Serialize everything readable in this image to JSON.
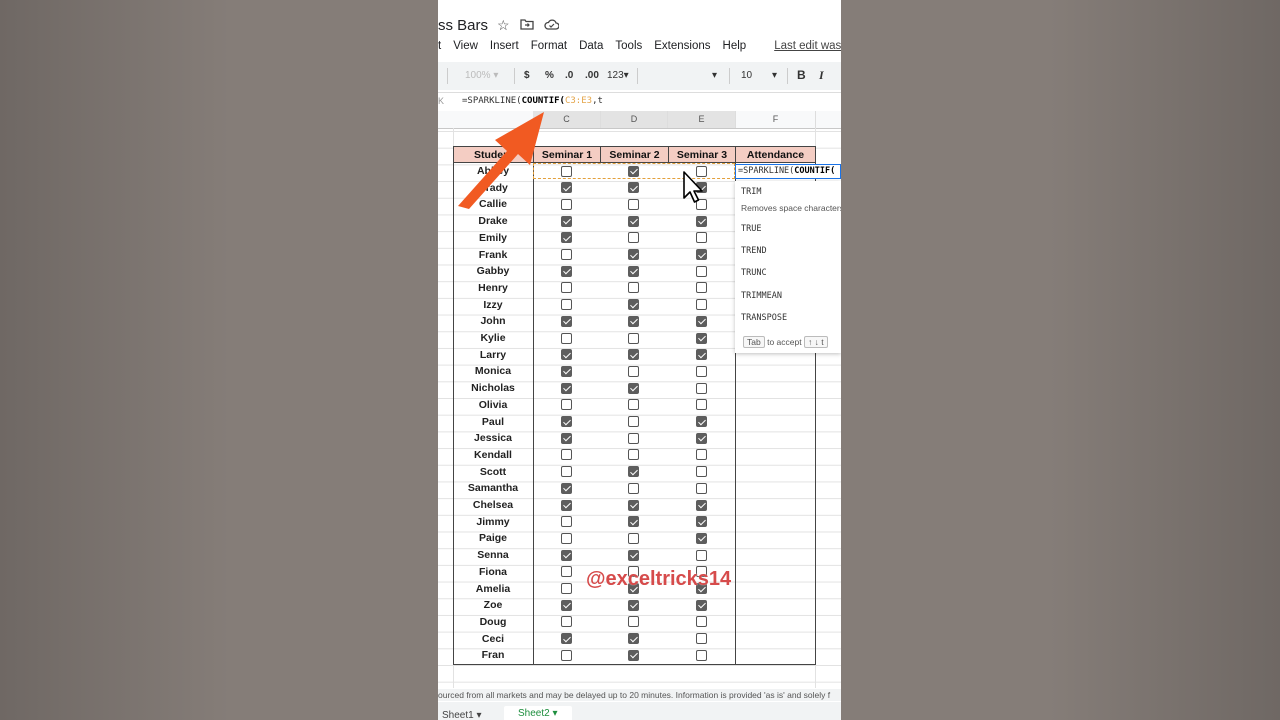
{
  "doc_title": "ss Bars",
  "icons": [
    "star-icon",
    "move-to-folder-icon",
    "cloud-status-icon"
  ],
  "menu": [
    "t",
    "View",
    "Insert",
    "Format",
    "Data",
    "Tools",
    "Extensions",
    "Help"
  ],
  "last_edit": "Last edit was sec",
  "toolbar": {
    "zoom": "100%",
    "currency": "$",
    "percent": "%",
    "dec_less": ".0",
    "dec_more": ".00",
    "format_more": "123▾",
    "font_size": "10",
    "bold": "B",
    "italic": "I"
  },
  "formula_bar": {
    "name_box": "K",
    "prefix": "=SPARKLINE(",
    "func": "COUNTIF(",
    "range": "C3:E3",
    "suffix": ",t"
  },
  "columns": [
    "C",
    "D",
    "E",
    "F"
  ],
  "table": {
    "headers": [
      "Student",
      "Seminar 1",
      "Seminar 2",
      "Seminar 3",
      "Attendance"
    ],
    "rows": [
      {
        "name": "Abbey",
        "s": [
          false,
          true,
          false
        ]
      },
      {
        "name": "Brady",
        "s": [
          true,
          true,
          true
        ]
      },
      {
        "name": "Callie",
        "s": [
          false,
          false,
          false
        ]
      },
      {
        "name": "Drake",
        "s": [
          true,
          true,
          true
        ]
      },
      {
        "name": "Emily",
        "s": [
          true,
          false,
          false
        ]
      },
      {
        "name": "Frank",
        "s": [
          false,
          true,
          true
        ]
      },
      {
        "name": "Gabby",
        "s": [
          true,
          true,
          false
        ]
      },
      {
        "name": "Henry",
        "s": [
          false,
          false,
          false
        ]
      },
      {
        "name": "Izzy",
        "s": [
          false,
          true,
          false
        ]
      },
      {
        "name": "John",
        "s": [
          true,
          true,
          true
        ]
      },
      {
        "name": "Kylie",
        "s": [
          false,
          false,
          true
        ]
      },
      {
        "name": "Larry",
        "s": [
          true,
          true,
          true
        ]
      },
      {
        "name": "Monica",
        "s": [
          true,
          false,
          false
        ]
      },
      {
        "name": "Nicholas",
        "s": [
          true,
          true,
          false
        ]
      },
      {
        "name": "Olivia",
        "s": [
          false,
          false,
          false
        ]
      },
      {
        "name": "Paul",
        "s": [
          true,
          false,
          true
        ]
      },
      {
        "name": "Jessica",
        "s": [
          true,
          false,
          true
        ]
      },
      {
        "name": "Kendall",
        "s": [
          false,
          false,
          false
        ]
      },
      {
        "name": "Scott",
        "s": [
          false,
          true,
          false
        ]
      },
      {
        "name": "Samantha",
        "s": [
          true,
          false,
          false
        ]
      },
      {
        "name": "Chelsea",
        "s": [
          true,
          true,
          true
        ]
      },
      {
        "name": "Jimmy",
        "s": [
          false,
          true,
          true
        ]
      },
      {
        "name": "Paige",
        "s": [
          false,
          false,
          true
        ]
      },
      {
        "name": "Senna",
        "s": [
          true,
          true,
          false
        ]
      },
      {
        "name": "Fiona",
        "s": [
          false,
          false,
          false
        ]
      },
      {
        "name": "Amelia",
        "s": [
          false,
          true,
          true
        ]
      },
      {
        "name": "Zoe",
        "s": [
          true,
          true,
          true
        ]
      },
      {
        "name": "Doug",
        "s": [
          false,
          false,
          false
        ]
      },
      {
        "name": "Ceci",
        "s": [
          true,
          true,
          false
        ]
      },
      {
        "name": "Fran",
        "s": [
          false,
          true,
          false
        ]
      }
    ]
  },
  "cell_formula": {
    "prefix": "=SPARKLINE(",
    "func": "COUNTIF("
  },
  "autocomplete": {
    "items": [
      "TRIM",
      "TRUE",
      "TREND",
      "TRUNC",
      "TRIMMEAN",
      "TRANSPOSE"
    ],
    "trim_description": "Removes space characters",
    "hint_key": "Tab",
    "hint_text": "to accept",
    "hint_arrows": "↑ ↓ t"
  },
  "disclaimer": "ourced from all markets and may be delayed up to 20 minutes. Information is provided 'as is' and solely f",
  "sheet_tabs": [
    "Sheet1 ▾",
    "Sheet2 ▾"
  ],
  "watermark": "@exceltricks14",
  "colors": {
    "header_fill": "#f4cdc3",
    "arrow": "#f15a22",
    "accent_green": "#1e8e3e"
  }
}
